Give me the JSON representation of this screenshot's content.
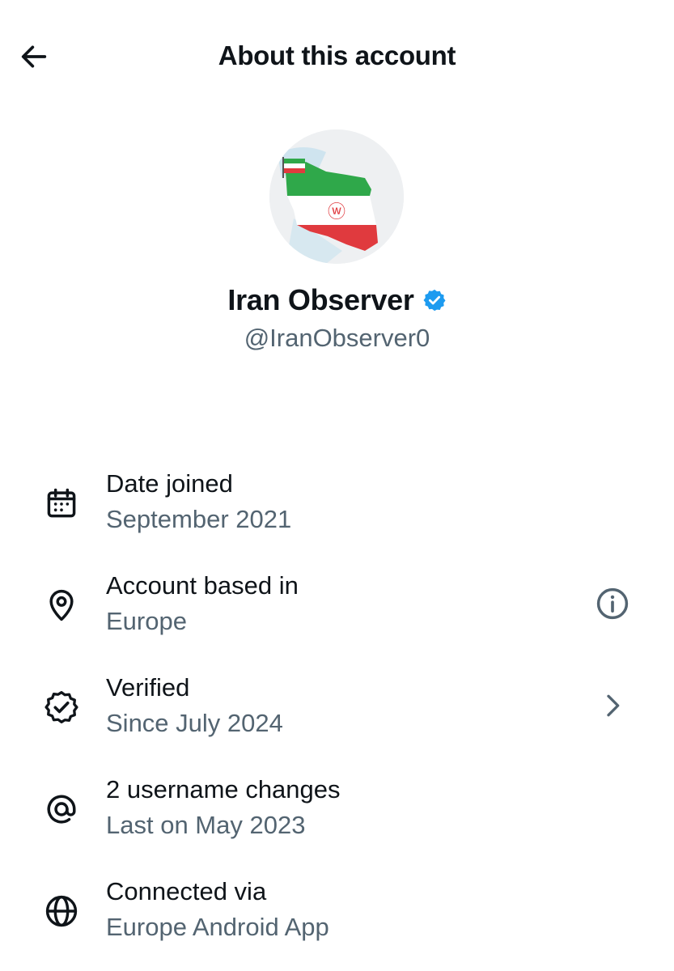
{
  "header": {
    "title": "About this account",
    "back_icon": "arrow-left-icon"
  },
  "profile": {
    "name": "Iran Observer",
    "handle": "@IranObserver0",
    "verified_badge_color": "#1d9bf0",
    "avatar_icon": "iran-flag-map-avatar"
  },
  "details": [
    {
      "icon": "calendar-icon",
      "label": "Date joined",
      "value": "September 2021"
    },
    {
      "icon": "location-pin-icon",
      "label": "Account based in",
      "value": "Europe",
      "trailing_icon": "info-icon"
    },
    {
      "icon": "verified-badge-icon",
      "label": "Verified",
      "value": "Since July 2024",
      "trailing_icon": "chevron-right-icon"
    },
    {
      "icon": "at-sign-icon",
      "label": "2 username changes",
      "value": "Last on May 2023"
    },
    {
      "icon": "globe-icon",
      "label": "Connected via",
      "value": "Europe Android App"
    }
  ],
  "colors": {
    "primary_text": "#0f1419",
    "secondary_text": "#536471",
    "accent": "#1d9bf0"
  }
}
